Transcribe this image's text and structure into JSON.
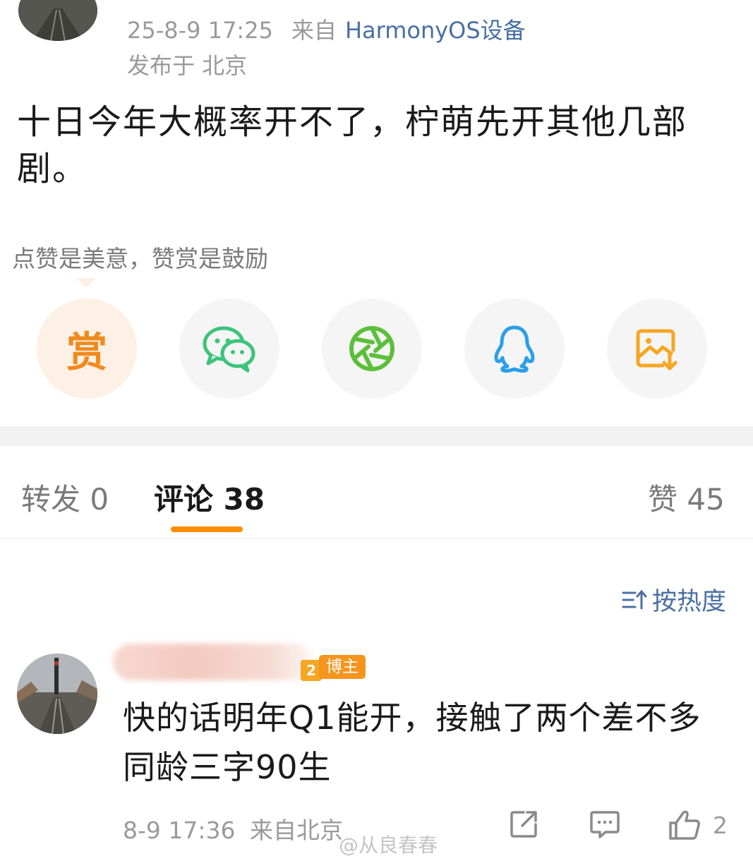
{
  "post": {
    "timestamp": "25-8-9 17:25",
    "source_prefix": "来自",
    "source": "HarmonyOS设备",
    "location": "发布于 北京",
    "text": "十日今年大概率开不了，柠萌先开其他几部剧。"
  },
  "reward": {
    "hint": "点赞是美意，赞赏是鼓励",
    "button_label": "赏"
  },
  "share_buttons": [
    {
      "icon": "reward-icon"
    },
    {
      "icon": "wechat-icon"
    },
    {
      "icon": "moments-icon"
    },
    {
      "icon": "qq-icon"
    },
    {
      "icon": "save-image-icon"
    }
  ],
  "tabs": {
    "repost": "转发 0",
    "comments": "评论 38",
    "likes": "赞 45",
    "active": "comments"
  },
  "sort": {
    "label": "按热度"
  },
  "comment": {
    "level": "2",
    "badge": "博主",
    "text": "快的话明年Q1能开，接触了两个差不多同龄三字90生",
    "time": "8-9 17:36",
    "location": "来自北京",
    "like_count": "2"
  },
  "watermark": "@从良春春",
  "colors": {
    "accent_orange": "#ff8c00",
    "link_blue": "#4a6fa3",
    "wechat_green": "#3cc47a",
    "qq_blue": "#2a9fe8",
    "save_orange": "#f5a623"
  }
}
